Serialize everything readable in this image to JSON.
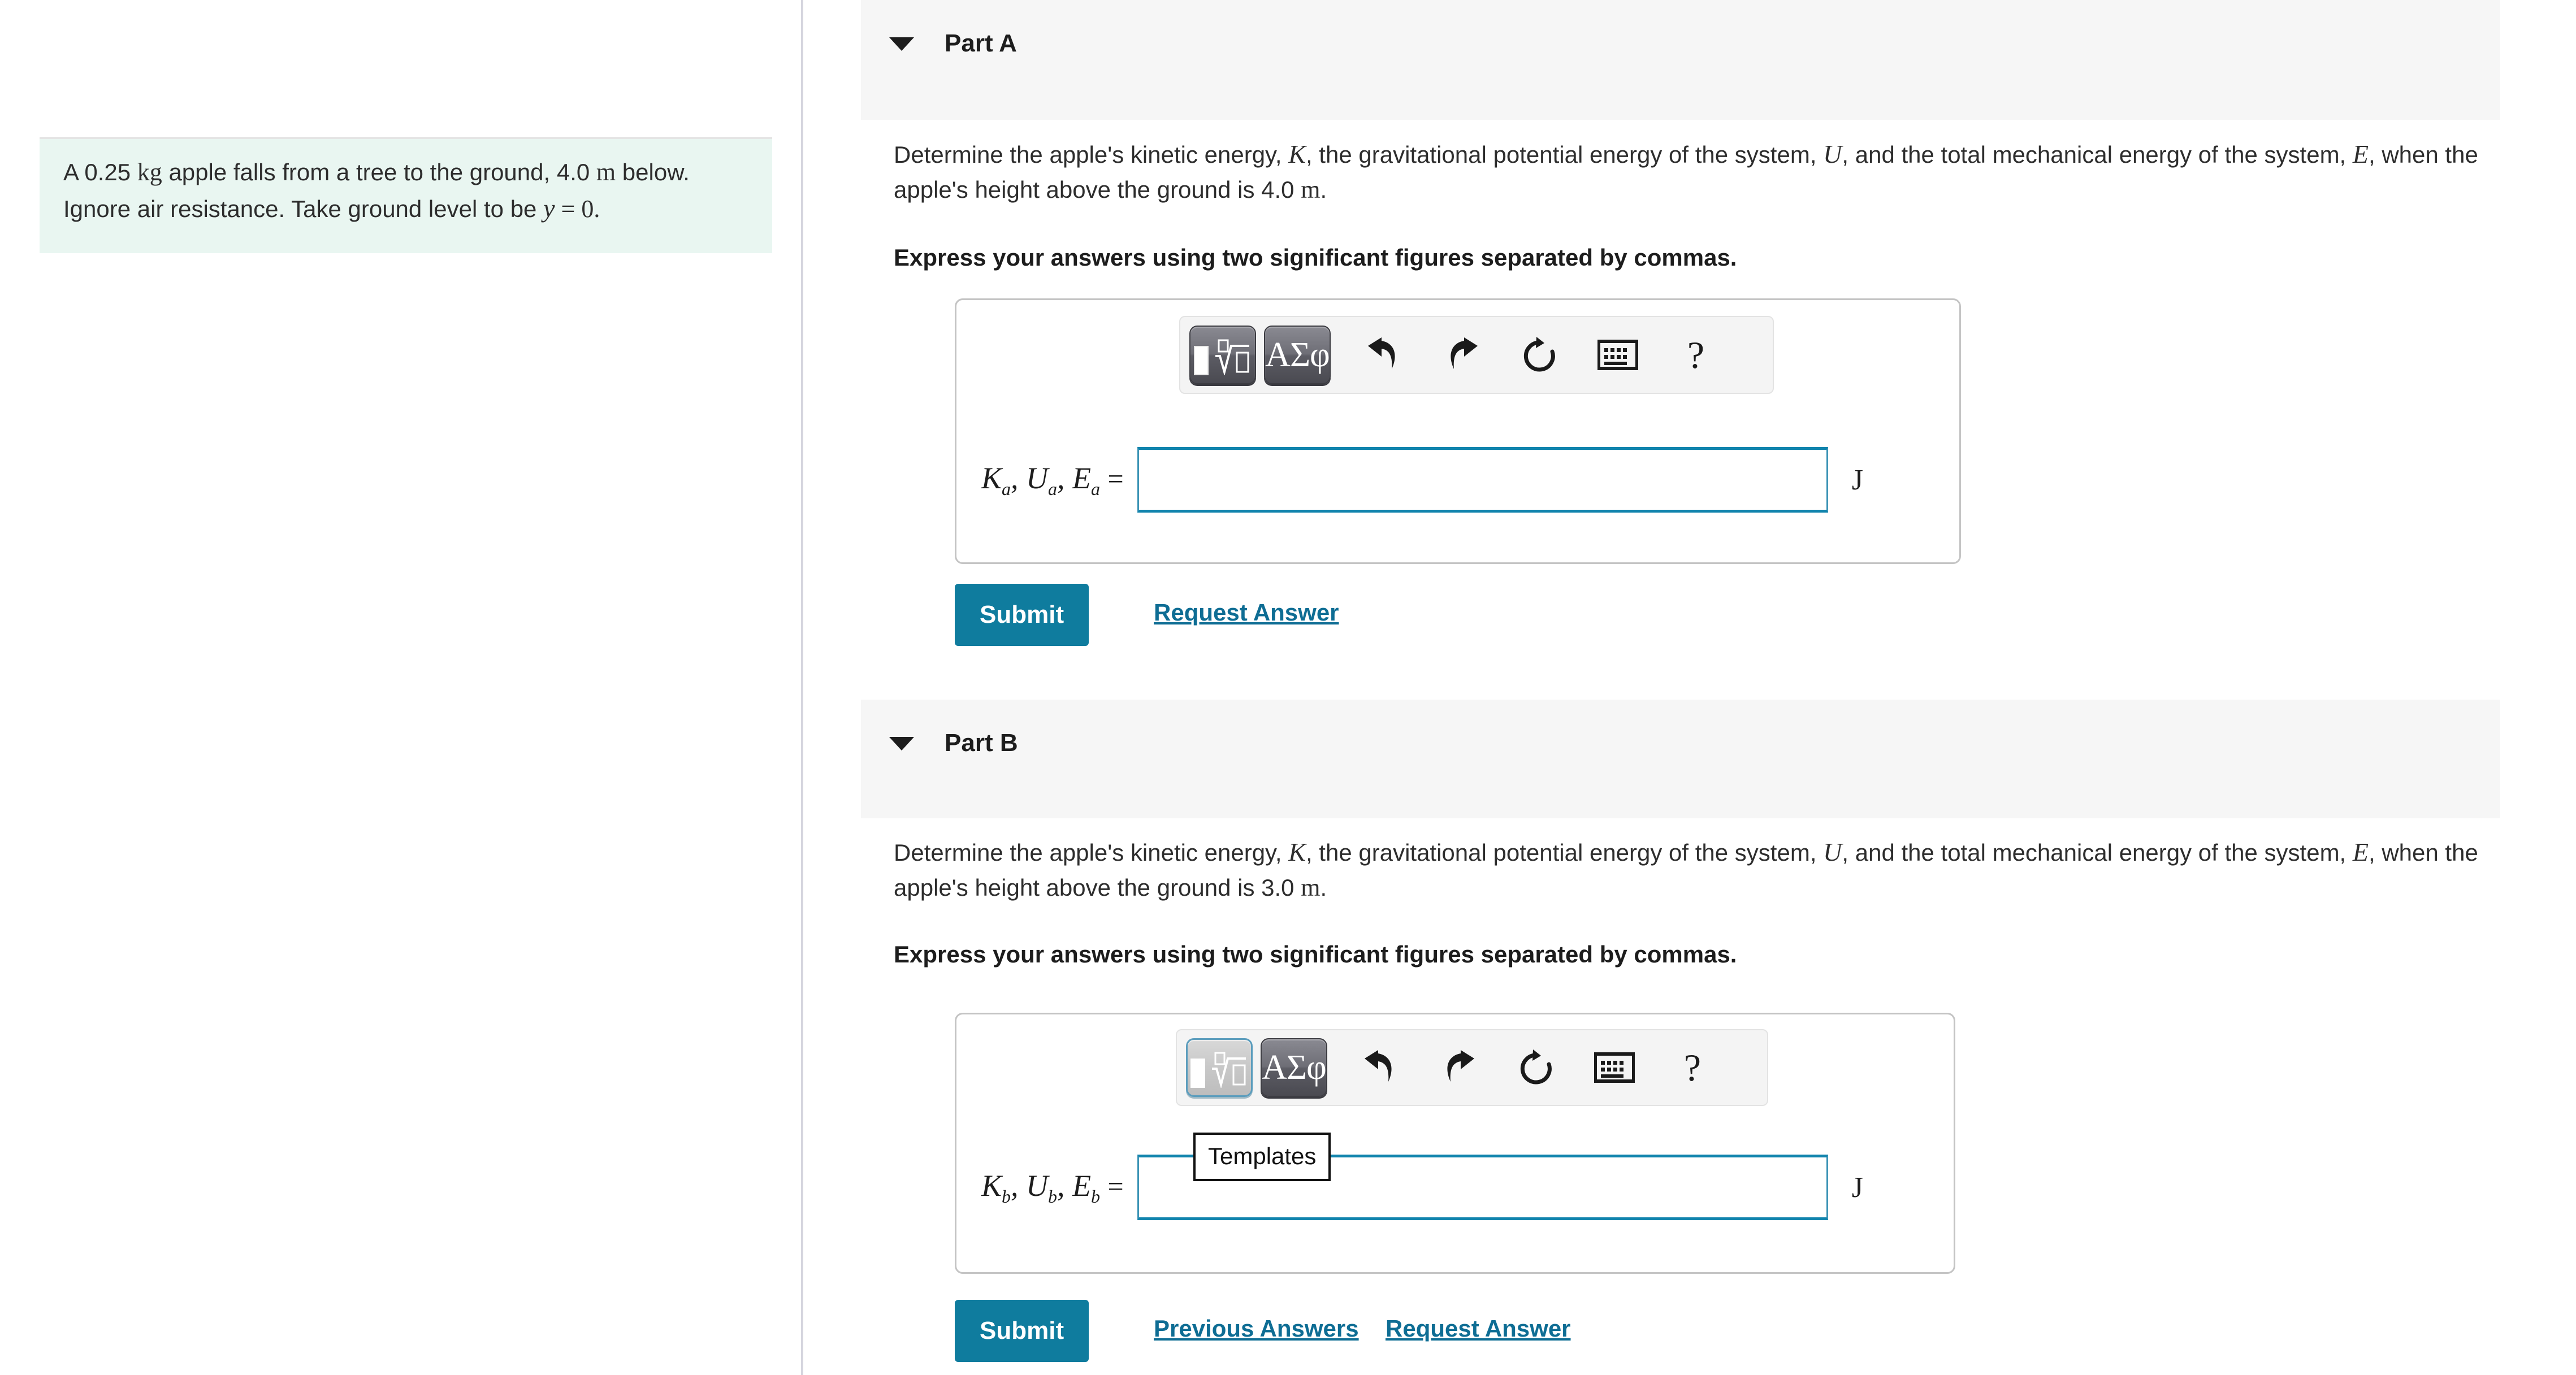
{
  "problem": {
    "text_line1_a": "A 0.25 ",
    "text_kg": "kg",
    "text_line1_b": " apple falls from a tree to the ground, 4.0",
    "text_m": "m",
    "text_line2": " below. Ignore air resistance. Take ground level",
    "text_line3": "to be ",
    "text_y": "y",
    "text_eq0": " = 0."
  },
  "parts": [
    {
      "id": "a",
      "title": "Part A",
      "caret_icon": "caret-down-icon",
      "question_line1_pre": "Determine the apple's kinetic energy, ",
      "sym_K": "K",
      "question_line1_mid": ", the gravitational potential energy of the system, ",
      "sym_U": "U",
      "question_line1_post": ", and the total mechanical",
      "question_line2_pre": "energy of the system, ",
      "sym_E": "E",
      "question_line2_post": ", when the apple's height above the ground is 4.0 ",
      "unit_m": "m",
      "question_line2_end": ".",
      "instruction": "Express your answers using two significant figures separated by commas.",
      "answer_label_K": "K",
      "answer_label_U": "U",
      "answer_label_E": "E",
      "answer_subscript": "a",
      "answer_equals": "=",
      "answer_value": "",
      "answer_unit": "J",
      "toolbar": {
        "templates_label": "Templates",
        "greek_label": "ΑΣφ",
        "undo_icon": "undo-arrow-icon",
        "redo_icon": "redo-arrow-icon",
        "reset_icon": "reset-circular-arrow-icon",
        "keyboard_icon": "keyboard-icon",
        "help_label": "?"
      },
      "submit_label": "Submit",
      "links": [
        "Request Answer"
      ]
    },
    {
      "id": "b",
      "title": "Part B",
      "caret_icon": "caret-down-icon",
      "question_line1_pre": "Determine the apple's kinetic energy, ",
      "sym_K": "K",
      "question_line1_mid": ", the gravitational potential energy of the system, ",
      "sym_U": "U",
      "question_line1_post": ", and the total mechanical",
      "question_line2_pre": "energy of the system, ",
      "sym_E": "E",
      "question_line2_post": ", when the apple's height above the ground is 3.0 ",
      "unit_m": "m",
      "question_line2_end": ".",
      "instruction": "Express your answers using two significant figures separated by commas.",
      "answer_label_K": "K",
      "answer_label_U": "U",
      "answer_label_E": "E",
      "answer_subscript": "b",
      "answer_equals": "=",
      "answer_value": "",
      "answer_unit": "J",
      "toolbar": {
        "templates_label": "Templates",
        "greek_label": "ΑΣφ",
        "undo_icon": "undo-arrow-icon",
        "redo_icon": "redo-arrow-icon",
        "reset_icon": "reset-circular-arrow-icon",
        "keyboard_icon": "keyboard-icon",
        "help_label": "?"
      },
      "tooltip_visible_label": "Templates",
      "submit_label": "Submit",
      "links": [
        "Previous Answers",
        "Request Answer"
      ]
    }
  ],
  "colors": {
    "prompt_bg": "#e9f6f1",
    "header_bg": "#f6f6f6",
    "submit_bg": "#0f7c9e",
    "link": "#0e6d94",
    "input_border": "#1184ad"
  }
}
